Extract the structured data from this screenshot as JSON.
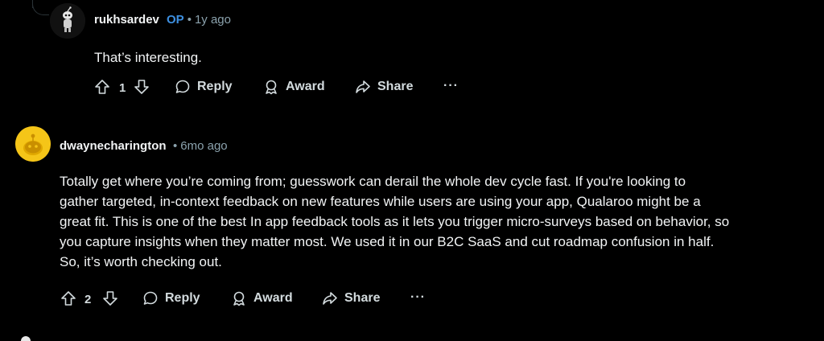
{
  "comments": [
    {
      "author": "rukhsardev",
      "op_badge": "OP",
      "separator": "•",
      "time": "1y ago",
      "body": "That’s interesting.",
      "votes": "1",
      "reply_label": "Reply",
      "award_label": "Award",
      "share_label": "Share",
      "more_label": "···"
    },
    {
      "author": "dwaynecharington",
      "separator": "•",
      "time": "6mo ago",
      "body_lines": [
        "Totally get where you’re coming from; guesswork can derail the whole dev cycle fast. If you're looking to",
        "gather targeted, in-context feedback on new features while users are using your app, Qualaroo might be a",
        "great fit. This is one of the best In app feedback tools as it lets you trigger micro-surveys based on behavior, so",
        "you capture insights when they matter most. We used it in our B2C SaaS and cut roadmap confusion in half.",
        "So, it’s worth checking out."
      ],
      "votes": "2",
      "reply_label": "Reply",
      "award_label": "Award",
      "share_label": "Share",
      "more_label": "···"
    }
  ],
  "colors": {
    "background": "#000000",
    "text": "#f2f4f5",
    "meta": "#8ba2ad",
    "op_badge": "#3d8fe0",
    "avatar_dark": "#1a1a1b",
    "avatar_yellow": "#f5c518"
  },
  "icons": [
    "upvote-icon",
    "downvote-icon",
    "reply-icon",
    "award-icon",
    "share-icon",
    "snoo-avatar"
  ]
}
